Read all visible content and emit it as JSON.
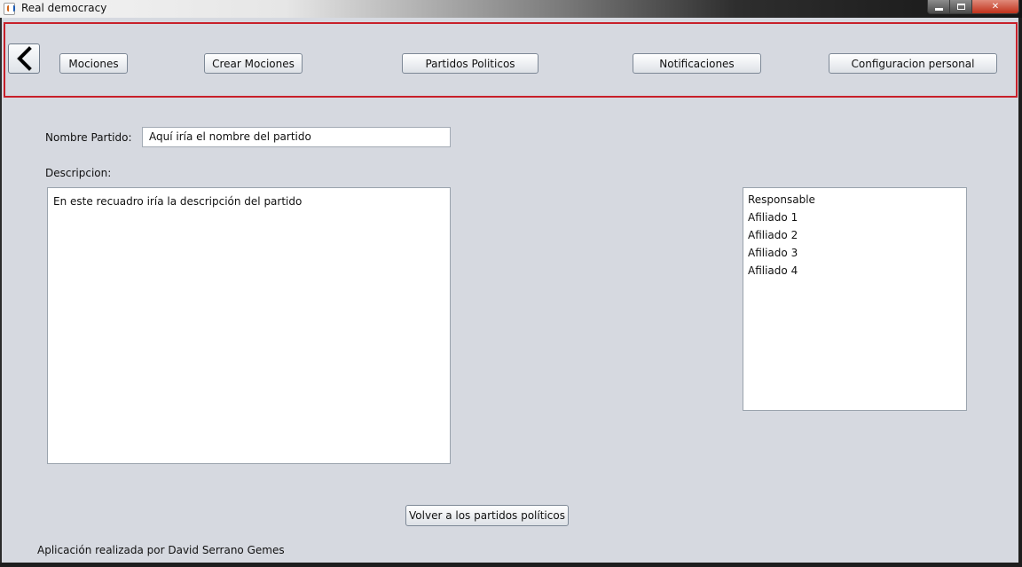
{
  "window": {
    "title": "Real democracy",
    "close_glyph": "✕",
    "icons": [
      "java-app-icon",
      "minimize-icon",
      "maximize-icon",
      "close-icon"
    ]
  },
  "nav": {
    "back_icon": "chevron-left-icon",
    "items": [
      {
        "label": "Mociones"
      },
      {
        "label": "Crear Mociones"
      },
      {
        "label": "Partidos Politicos"
      },
      {
        "label": "Notificaciones"
      },
      {
        "label": "Configuracion personal"
      }
    ]
  },
  "form": {
    "name_label": "Nombre Partido:",
    "name_value": "Aquí  iría el nombre del partido",
    "description_label": "Descripcion:",
    "description_value": "En este recuadro iría la descripción del partido"
  },
  "members": [
    "Responsable",
    "Afiliado 1",
    "Afiliado 2",
    "Afiliado 3",
    "Afiliado 4"
  ],
  "back_to_parties_label": "Volver a los partidos políticos",
  "footer": "Aplicación realizada por David Serrano Gemes",
  "colors": {
    "background": "#d6d9e0",
    "nav_border": "#c8202a"
  }
}
